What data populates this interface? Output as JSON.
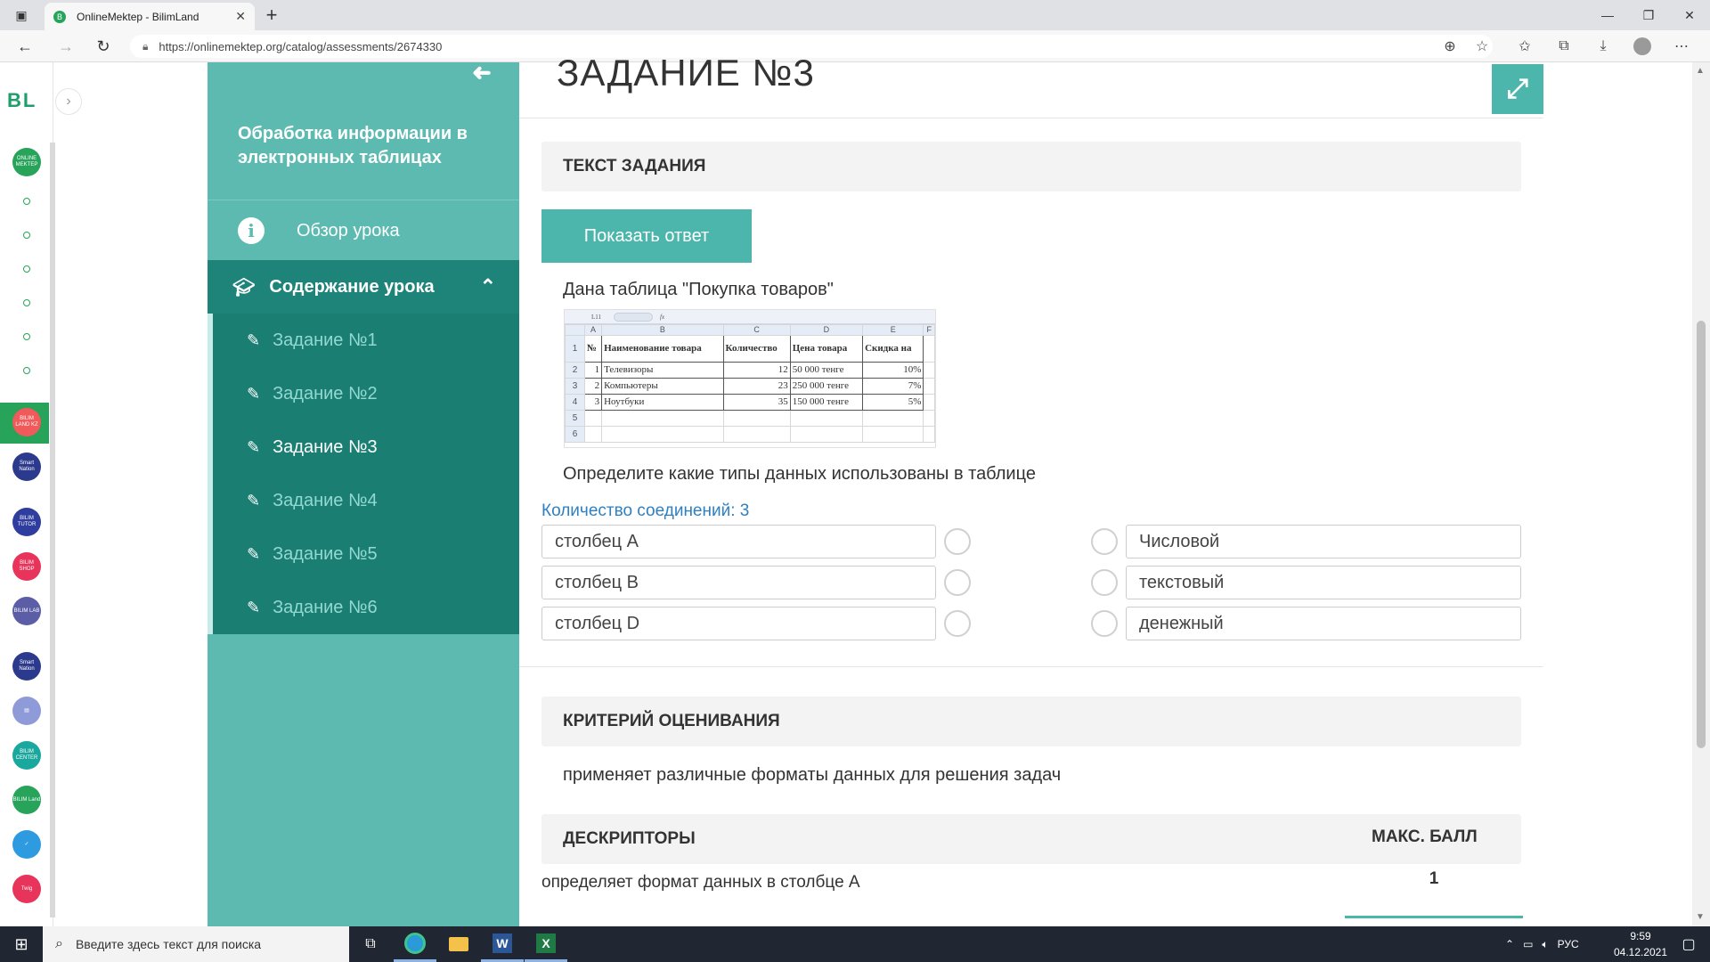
{
  "browser": {
    "tab_title": "OnlineMektep - BilimLand",
    "tab_favicon": "B",
    "url": "https://onlinemektep.org/catalog/assessments/2674330",
    "new_tab": "+",
    "min": "—",
    "restore": "❐",
    "close": "✕",
    "back": "←",
    "forward": "→",
    "reload": "↻"
  },
  "rail": {
    "logo": "BL",
    "toggle": "›",
    "apps": [
      {
        "label": "ONLINE MEKTEP",
        "color": "#27a35a"
      },
      {
        "label": "BILIM LAND KZ",
        "color": "#f05a5a"
      },
      {
        "label": "Smart Nation",
        "color": "#2b3a8c"
      },
      {
        "label": "BILIM TUTOR",
        "color": "#2f3e9e"
      },
      {
        "label": "BILIM SHOP",
        "color": "#e8335a"
      },
      {
        "label": "BILIM LAB",
        "color": "#5b5ea6"
      },
      {
        "label": "Smart Nation",
        "color": "#2b3a8c"
      },
      {
        "label": "▤",
        "color": "#8e9bd8"
      },
      {
        "label": "BILIM CENTER",
        "color": "#1aa89e"
      },
      {
        "label": "BILIM Land",
        "color": "#27a35a"
      },
      {
        "label": "✓",
        "color": "#2e9be0"
      },
      {
        "label": "Twig",
        "color": "#e8335a"
      }
    ]
  },
  "sidebar": {
    "back_icon": "➜",
    "title": "Обработка информации в электронных таблицах",
    "overview_label": "Обзор урока",
    "content_label": "Содержание урока",
    "tasks": [
      "Задание №1",
      "Задание №2",
      "Задание №3",
      "Задание №4",
      "Задание №5",
      "Задание №6"
    ],
    "active_task_index": 2
  },
  "main": {
    "title": "ЗАДАНИЕ №3",
    "task_text_header": "ТЕКСТ ЗАДАНИЯ",
    "show_answer": "Показать ответ",
    "intro": "Дана таблица \"Покупка товаров\"",
    "question": "Определите какие типы данных использованы в таблице",
    "connections": "Количество соединений: 3",
    "left_items": [
      "столбец A",
      "столбец B",
      "столбец D"
    ],
    "right_items": [
      "Числовой",
      "текстовый",
      "денежный"
    ],
    "criteria_header": "КРИТЕРИЙ ОЦЕНИВАНИЯ",
    "criteria_text": "применяет различные форматы данных для решения задач",
    "descriptors_header": "ДЕСКРИПТОРЫ",
    "max_score_header": "МАКС. БАЛЛ",
    "descriptor_1": "определяет формат данных в столбце А",
    "descriptor_1_score": "1"
  },
  "excel": {
    "cell_ref": "L11",
    "fx": "fx",
    "columns": [
      "",
      "A",
      "B",
      "C",
      "D",
      "E",
      "F"
    ],
    "header_row": {
      "num": "1",
      "a": "№",
      "b": "Наименование товара",
      "c": "Количество",
      "d": "Цена товара",
      "e": "Скидка на"
    },
    "rows": [
      {
        "num": "2",
        "a": "1",
        "b": "Телевизоры",
        "c": "12",
        "d": "50 000 тенге",
        "e": "10%"
      },
      {
        "num": "3",
        "a": "2",
        "b": "Компьютеры",
        "c": "23",
        "d": "250 000 тенге",
        "e": "7%"
      },
      {
        "num": "4",
        "a": "3",
        "b": "Ноутбуки",
        "c": "35",
        "d": "150 000 тенге",
        "e": "5%"
      }
    ],
    "extra_rows": [
      "5",
      "6"
    ]
  },
  "taskbar": {
    "search_placeholder": "Введите здесь текст для поиска",
    "lang": "РУС",
    "time": "9:59",
    "date": "04.12.2021"
  }
}
